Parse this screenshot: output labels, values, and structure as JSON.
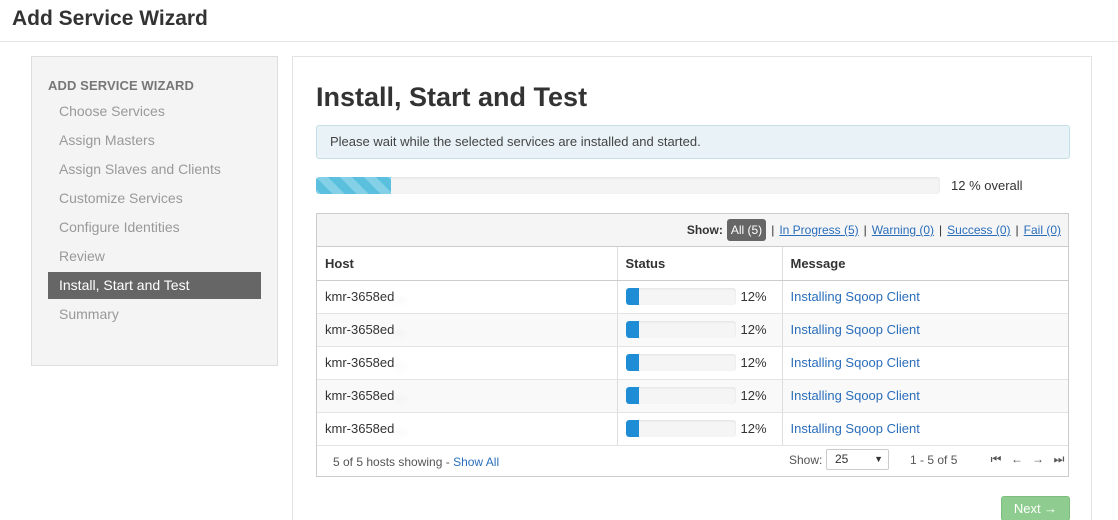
{
  "app": {
    "title": "Add Service Wizard"
  },
  "sidebar": {
    "heading": "ADD SERVICE WIZARD",
    "items": [
      {
        "label": "Choose Services"
      },
      {
        "label": "Assign Masters"
      },
      {
        "label": "Assign Slaves and Clients"
      },
      {
        "label": "Customize Services"
      },
      {
        "label": "Configure Identities"
      },
      {
        "label": "Review"
      },
      {
        "label": "Install, Start and Test",
        "active": true
      },
      {
        "label": "Summary"
      }
    ]
  },
  "main": {
    "title": "Install, Start and Test",
    "alert": "Please wait while the selected services are installed and started.",
    "overall_progress": {
      "percent": 12,
      "label": "12 % overall"
    }
  },
  "filter": {
    "show_label": "Show:",
    "options": [
      {
        "label": "All (5)",
        "active": true
      },
      {
        "label": "In Progress (5)"
      },
      {
        "label": "Warning (0)"
      },
      {
        "label": "Success (0)"
      },
      {
        "label": "Fail (0)"
      }
    ],
    "separator": "|"
  },
  "table": {
    "columns": [
      "Host",
      "Status",
      "Message"
    ],
    "rows": [
      {
        "host_prefix": "kmr-3658ed",
        "host_rest": "...",
        "percent": 12,
        "percent_label": "12%",
        "message": "Installing Sqoop Client"
      },
      {
        "host_prefix": "kmr-3658ed",
        "host_rest": "...",
        "percent": 12,
        "percent_label": "12%",
        "message": "Installing Sqoop Client"
      },
      {
        "host_prefix": "kmr-3658ed",
        "host_rest": "...",
        "percent": 12,
        "percent_label": "12%",
        "message": "Installing Sqoop Client"
      },
      {
        "host_prefix": "kmr-3658ed",
        "host_rest": "...",
        "percent": 12,
        "percent_label": "12%",
        "message": "Installing Sqoop Client"
      },
      {
        "host_prefix": "kmr-3658ed",
        "host_rest": "...",
        "percent": 12,
        "percent_label": "12%",
        "message": "Installing Sqoop Client"
      }
    ]
  },
  "footer": {
    "showing_text": "5 of 5 hosts showing - ",
    "show_all": "Show All",
    "page_size_label": "Show:",
    "page_size": "25",
    "caret": "▼",
    "range": "1 - 5 of 5",
    "pager_icons": {
      "first": "⏮",
      "prev": "←",
      "next": "→",
      "last": "⏭"
    }
  },
  "actions": {
    "next_label": "Next →"
  }
}
